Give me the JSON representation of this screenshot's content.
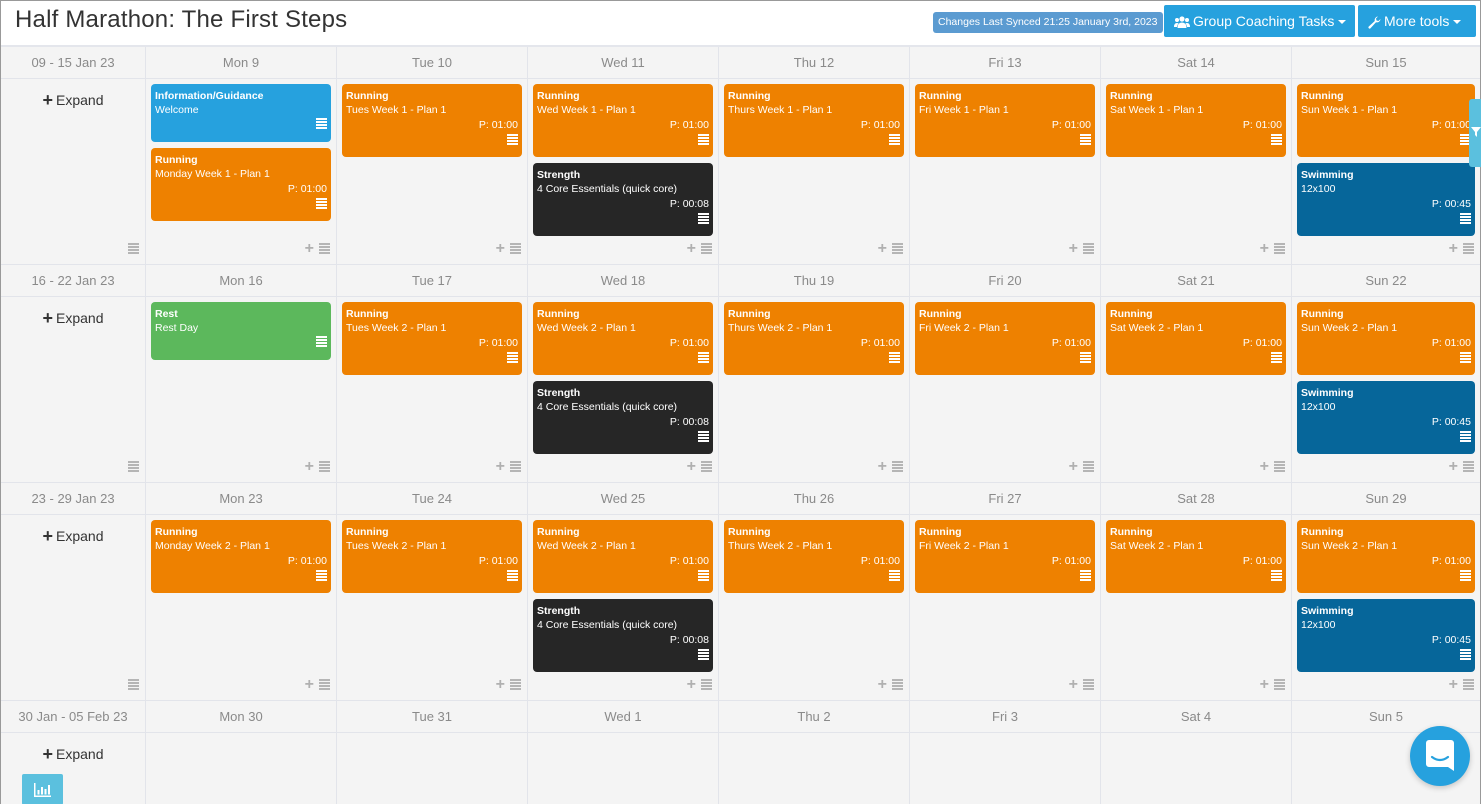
{
  "header": {
    "title": "Half Marathon: The First Steps",
    "sync_status": "Changes Last Synced 21:25 January 3rd, 2023",
    "group_coaching_label": "Group Coaching Tasks",
    "more_tools_label": "More tools"
  },
  "expand_label": "Expand",
  "colors": {
    "running": "#ee8100",
    "info": "#26a1de",
    "rest": "#5cb85c",
    "strength": "#262626",
    "swimming": "#06669a",
    "accent": "#26a1de"
  },
  "weeks": [
    {
      "range": "09 - 15 Jan 23",
      "days": [
        {
          "label": "Mon 9",
          "sessions": [
            {
              "kind": "info",
              "type": "Information/Guidance",
              "name": "Welcome",
              "duration": ""
            },
            {
              "kind": "run",
              "type": "Running",
              "name": "Monday Week 1 - Plan 1",
              "duration": "P: 01:00"
            }
          ]
        },
        {
          "label": "Tue 10",
          "sessions": [
            {
              "kind": "run",
              "type": "Running",
              "name": "Tues Week 1 - Plan 1",
              "duration": "P: 01:00"
            }
          ]
        },
        {
          "label": "Wed 11",
          "sessions": [
            {
              "kind": "run",
              "type": "Running",
              "name": "Wed Week 1 - Plan 1",
              "duration": "P: 01:00"
            },
            {
              "kind": "str",
              "type": "Strength",
              "name": "4 Core Essentials (quick core)",
              "duration": "P: 00:08"
            }
          ]
        },
        {
          "label": "Thu 12",
          "sessions": [
            {
              "kind": "run",
              "type": "Running",
              "name": "Thurs Week 1 - Plan 1",
              "duration": "P: 01:00"
            }
          ]
        },
        {
          "label": "Fri 13",
          "sessions": [
            {
              "kind": "run",
              "type": "Running",
              "name": "Fri Week 1 - Plan 1",
              "duration": "P: 01:00"
            }
          ]
        },
        {
          "label": "Sat 14",
          "sessions": [
            {
              "kind": "run",
              "type": "Running",
              "name": "Sat Week 1 - Plan 1",
              "duration": "P: 01:00"
            }
          ]
        },
        {
          "label": "Sun 15",
          "sessions": [
            {
              "kind": "run",
              "type": "Running",
              "name": "Sun Week 1 - Plan 1",
              "duration": "P: 01:00"
            },
            {
              "kind": "swim",
              "type": "Swimming",
              "name": "12x100",
              "duration": "P: 00:45"
            }
          ]
        }
      ]
    },
    {
      "range": "16 - 22 Jan 23",
      "days": [
        {
          "label": "Mon 16",
          "sessions": [
            {
              "kind": "rest",
              "type": "Rest",
              "name": "Rest Day",
              "duration": ""
            }
          ]
        },
        {
          "label": "Tue 17",
          "sessions": [
            {
              "kind": "run",
              "type": "Running",
              "name": "Tues Week 2 - Plan 1",
              "duration": "P: 01:00"
            }
          ]
        },
        {
          "label": "Wed 18",
          "sessions": [
            {
              "kind": "run",
              "type": "Running",
              "name": "Wed Week 2 - Plan 1",
              "duration": "P: 01:00"
            },
            {
              "kind": "str",
              "type": "Strength",
              "name": "4 Core Essentials (quick core)",
              "duration": "P: 00:08"
            }
          ]
        },
        {
          "label": "Thu 19",
          "sessions": [
            {
              "kind": "run",
              "type": "Running",
              "name": "Thurs Week 2 - Plan 1",
              "duration": "P: 01:00"
            }
          ]
        },
        {
          "label": "Fri 20",
          "sessions": [
            {
              "kind": "run",
              "type": "Running",
              "name": "Fri Week 2 - Plan 1",
              "duration": "P: 01:00"
            }
          ]
        },
        {
          "label": "Sat 21",
          "sessions": [
            {
              "kind": "run",
              "type": "Running",
              "name": "Sat Week 2 - Plan 1",
              "duration": "P: 01:00"
            }
          ]
        },
        {
          "label": "Sun 22",
          "sessions": [
            {
              "kind": "run",
              "type": "Running",
              "name": "Sun Week 2 - Plan 1",
              "duration": "P: 01:00"
            },
            {
              "kind": "swim",
              "type": "Swimming",
              "name": "12x100",
              "duration": "P: 00:45"
            }
          ]
        }
      ]
    },
    {
      "range": "23 - 29 Jan 23",
      "days": [
        {
          "label": "Mon 23",
          "sessions": [
            {
              "kind": "run",
              "type": "Running",
              "name": "Monday Week 2 - Plan 1",
              "duration": "P: 01:00"
            }
          ]
        },
        {
          "label": "Tue 24",
          "sessions": [
            {
              "kind": "run",
              "type": "Running",
              "name": "Tues Week 2 - Plan 1",
              "duration": "P: 01:00"
            }
          ]
        },
        {
          "label": "Wed 25",
          "sessions": [
            {
              "kind": "run",
              "type": "Running",
              "name": "Wed Week 2 - Plan 1",
              "duration": "P: 01:00"
            },
            {
              "kind": "str",
              "type": "Strength",
              "name": "4 Core Essentials (quick core)",
              "duration": "P: 00:08"
            }
          ]
        },
        {
          "label": "Thu 26",
          "sessions": [
            {
              "kind": "run",
              "type": "Running",
              "name": "Thurs Week 2 - Plan 1",
              "duration": "P: 01:00"
            }
          ]
        },
        {
          "label": "Fri 27",
          "sessions": [
            {
              "kind": "run",
              "type": "Running",
              "name": "Fri Week 2 - Plan 1",
              "duration": "P: 01:00"
            }
          ]
        },
        {
          "label": "Sat 28",
          "sessions": [
            {
              "kind": "run",
              "type": "Running",
              "name": "Sat Week 2 - Plan 1",
              "duration": "P: 01:00"
            }
          ]
        },
        {
          "label": "Sun 29",
          "sessions": [
            {
              "kind": "run",
              "type": "Running",
              "name": "Sun Week 2 - Plan 1",
              "duration": "P: 01:00"
            },
            {
              "kind": "swim",
              "type": "Swimming",
              "name": "12x100",
              "duration": "P: 00:45"
            }
          ]
        }
      ]
    },
    {
      "range": "30 Jan - 05 Feb 23",
      "days": [
        {
          "label": "Mon 30",
          "sessions": []
        },
        {
          "label": "Tue 31",
          "sessions": []
        },
        {
          "label": "Wed 1",
          "sessions": []
        },
        {
          "label": "Thu 2",
          "sessions": []
        },
        {
          "label": "Fri 3",
          "sessions": []
        },
        {
          "label": "Sat 4",
          "sessions": []
        },
        {
          "label": "Sun 5",
          "sessions": []
        }
      ]
    }
  ],
  "icons": {
    "group": "users-icon",
    "tools": "wrench-icon",
    "filter": "filter-icon",
    "chat": "chat-icon",
    "stats": "bar-chart-icon",
    "menu": "hamburger-icon",
    "add": "plus-icon"
  }
}
